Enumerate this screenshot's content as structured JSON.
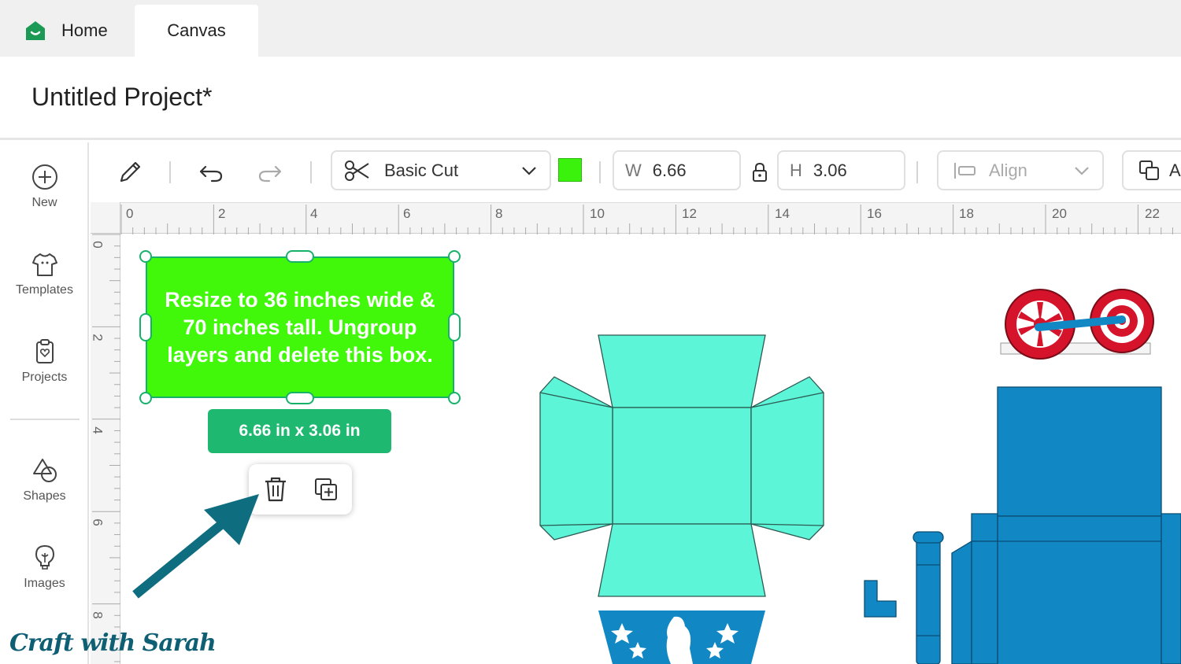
{
  "tabs": {
    "home": "Home",
    "canvas": "Canvas"
  },
  "project": {
    "title": "Untitled Project*"
  },
  "sidebar": {
    "items": [
      {
        "label": "New",
        "icon": "plus-circle-icon"
      },
      {
        "label": "Templates",
        "icon": "tshirt-icon"
      },
      {
        "label": "Projects",
        "icon": "clipboard-heart-icon"
      },
      {
        "label": "Shapes",
        "icon": "shapes-icon"
      },
      {
        "label": "Images",
        "icon": "lightbulb-icon"
      }
    ]
  },
  "toolbar": {
    "operation": "Basic Cut",
    "color": "#3af20b",
    "width_label": "W",
    "width_value": "6.66",
    "height_label": "H",
    "height_value": "3.06",
    "align_label": "Align",
    "arrange_label": "A"
  },
  "ruler": {
    "top": [
      "0",
      "2",
      "4",
      "6",
      "8",
      "10",
      "12",
      "14",
      "16",
      "18",
      "20",
      "22"
    ],
    "left": [
      "0",
      "2",
      "4",
      "6",
      "8"
    ]
  },
  "canvas": {
    "instruction_text": "Resize to 36 inches wide & 70 inches tall. Ungroup layers and delete this box.",
    "size_badge": "6.66  in x 3.06  in"
  },
  "colors": {
    "accent": "#17b26a",
    "selection_fill": "#42f80a",
    "panel_teal": "#5cf5d8",
    "panel_blue": "#1187c4",
    "wheel_red": "#d5132b",
    "arrow": "#0f6d80"
  },
  "watermark": "Craft with Sarah"
}
